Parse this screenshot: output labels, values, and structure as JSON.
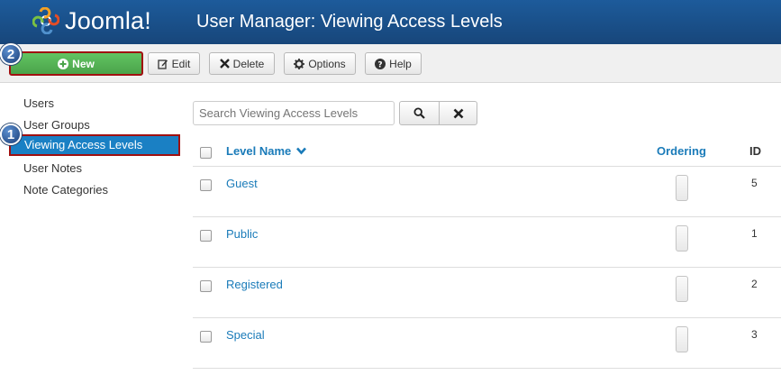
{
  "header": {
    "logo_text": "Joomla!",
    "title": "User Manager: Viewing Access Levels",
    "bg_color": "#1a5190"
  },
  "toolbar": {
    "new_label": "New",
    "edit_label": "Edit",
    "delete_label": "Delete",
    "options_label": "Options",
    "help_label": "Help"
  },
  "badges": {
    "one": "1",
    "two": "2"
  },
  "sidebar": {
    "items": [
      {
        "label": "Users"
      },
      {
        "label": "User Groups"
      },
      {
        "label": "Viewing Access Levels",
        "active": true
      },
      {
        "label": "User Notes"
      },
      {
        "label": "Note Categories"
      }
    ]
  },
  "search": {
    "placeholder": "Search Viewing Access Levels"
  },
  "table": {
    "columns": {
      "level_name": "Level Name",
      "ordering": "Ordering",
      "id": "ID"
    },
    "rows": [
      {
        "name": "Guest",
        "id": "5"
      },
      {
        "name": "Public",
        "id": "1"
      },
      {
        "name": "Registered",
        "id": "2"
      },
      {
        "name": "Special",
        "id": "3"
      }
    ]
  },
  "colors": {
    "link": "#1a7bb9",
    "active": "#1a80c4",
    "new_button": "#55b455",
    "highlight_border": "#a01010"
  }
}
